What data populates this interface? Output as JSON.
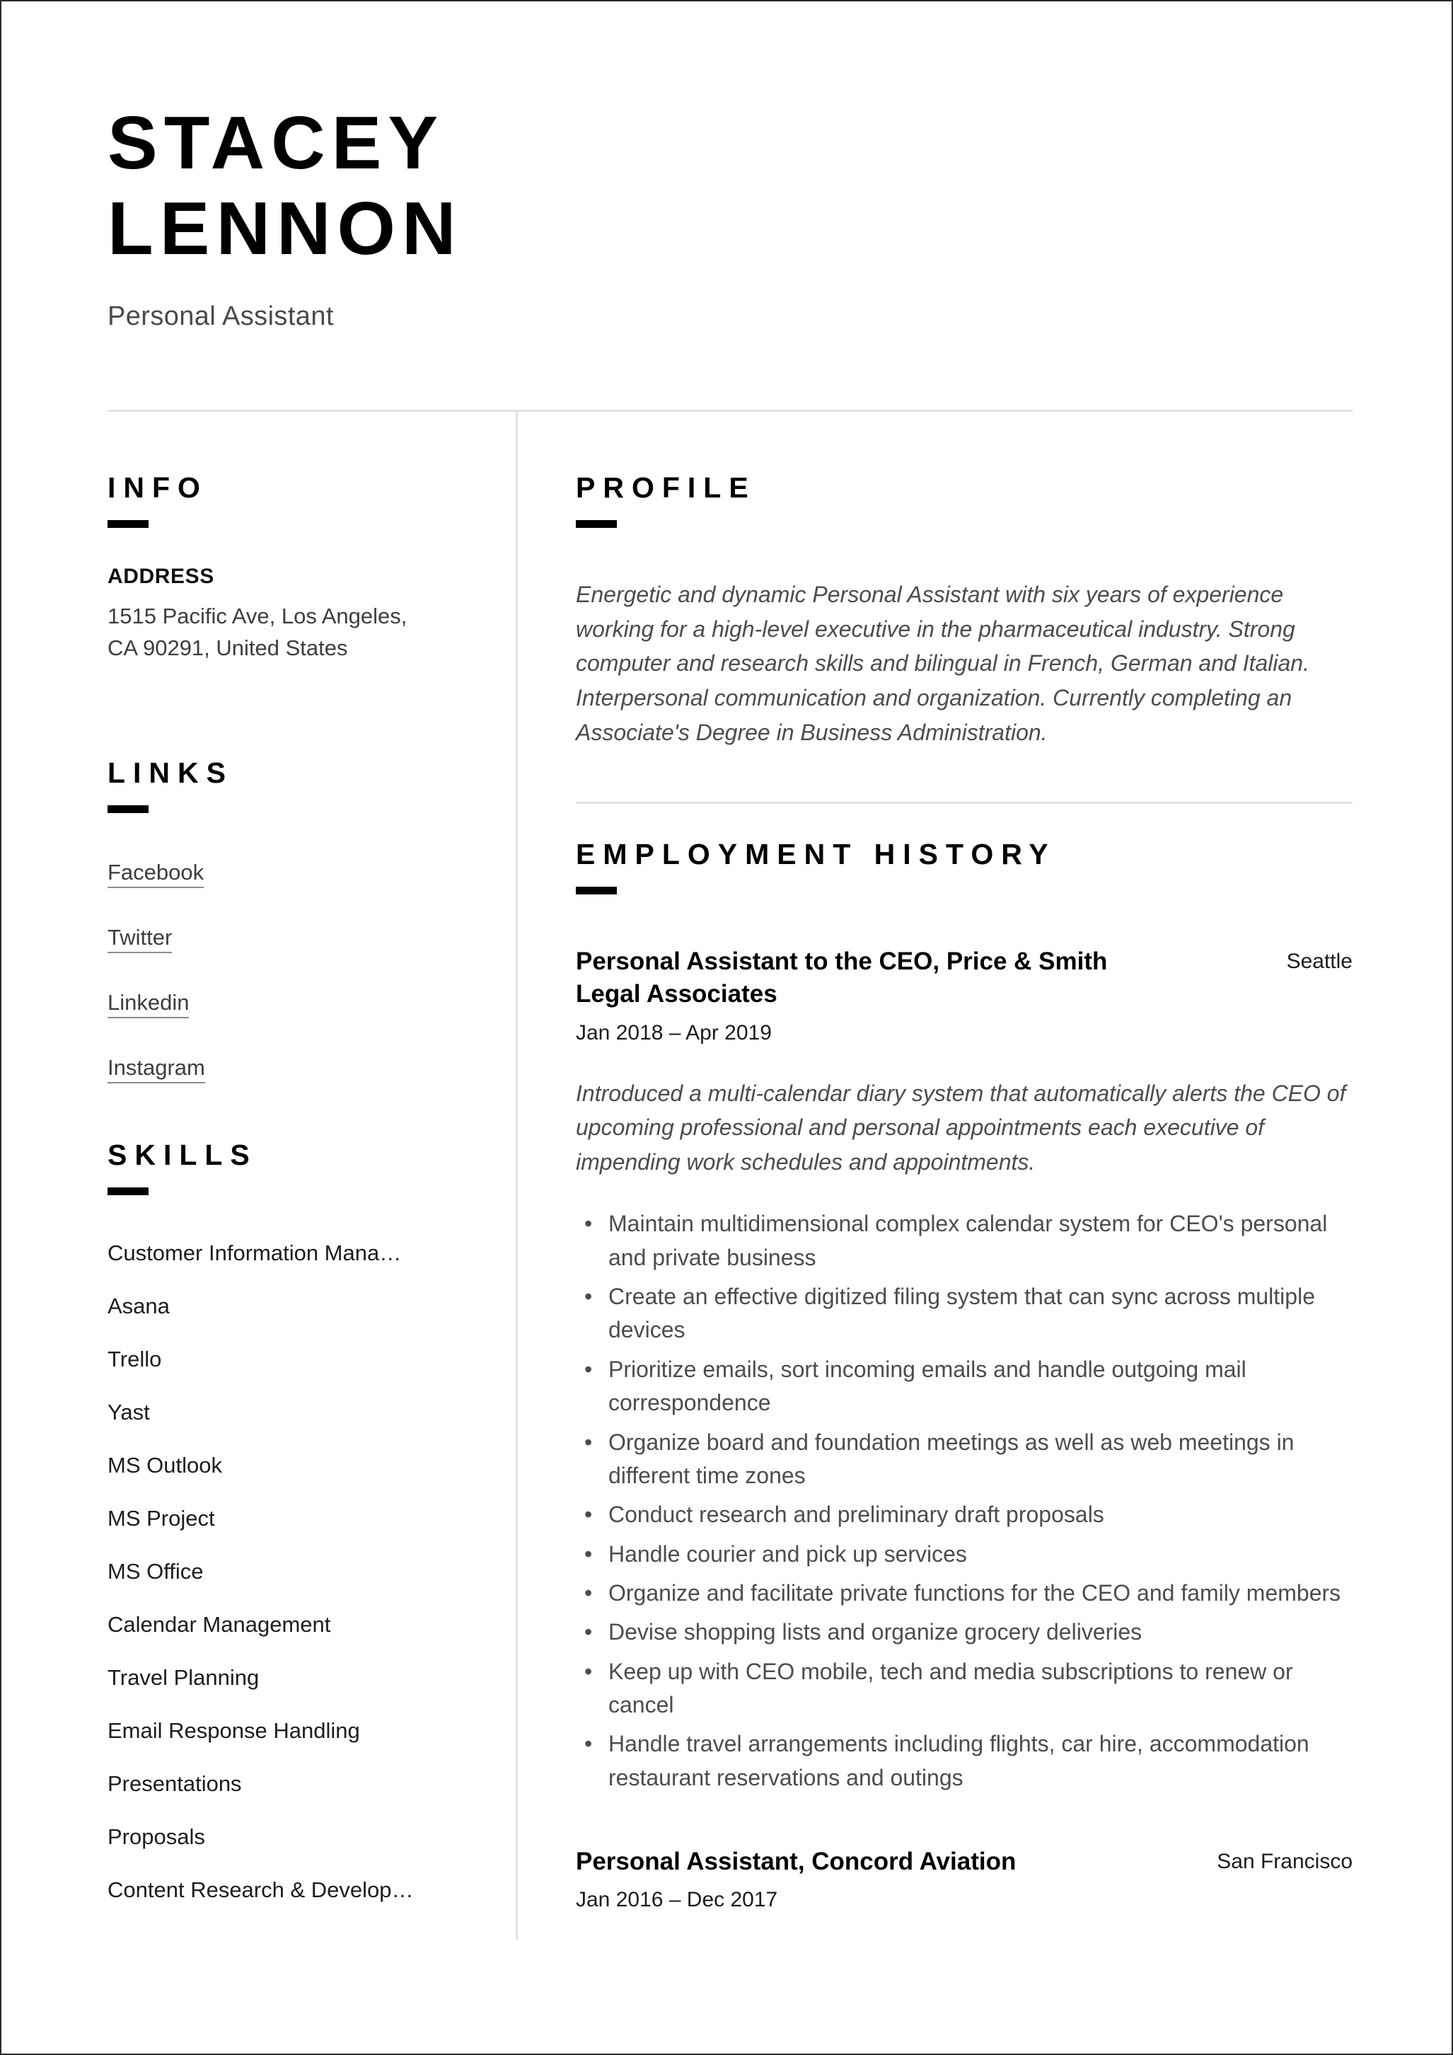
{
  "header": {
    "first_name": "STACEY",
    "last_name": "LENNON",
    "job_title": "Personal Assistant"
  },
  "sidebar": {
    "info": {
      "heading": "INFO",
      "address_label": "ADDRESS",
      "address_line1": "1515 Pacific Ave, Los Angeles,",
      "address_line2": "CA 90291, United States"
    },
    "links": {
      "heading": "LINKS",
      "items": [
        {
          "label": "Facebook"
        },
        {
          "label": "Twitter"
        },
        {
          "label": "Linkedin"
        },
        {
          "label": "Instagram"
        }
      ]
    },
    "skills": {
      "heading": "SKILLS",
      "items": [
        {
          "label": "Customer Information Mana…"
        },
        {
          "label": "Asana"
        },
        {
          "label": "Trello"
        },
        {
          "label": "Yast"
        },
        {
          "label": "MS Outlook"
        },
        {
          "label": "MS Project"
        },
        {
          "label": "MS Office"
        },
        {
          "label": "Calendar Management"
        },
        {
          "label": "Travel Planning"
        },
        {
          "label": "Email Response Handling"
        },
        {
          "label": "Presentations"
        },
        {
          "label": "Proposals"
        },
        {
          "label": "Content Research & Develop…"
        }
      ]
    }
  },
  "main": {
    "profile": {
      "heading": "PROFILE",
      "text": "Energetic and dynamic Personal Assistant with six years of experience working for a high-level executive in the pharmaceutical industry. Strong computer and research skills and bilingual in French, German and Italian. Interpersonal communication and organization. Currently completing an Associate's Degree in Business Administration."
    },
    "employment": {
      "heading": "EMPLOYMENT HISTORY",
      "jobs": [
        {
          "role": "Personal Assistant to the CEO, Price & Smith Legal Associates",
          "location": "Seattle",
          "dates": "Jan 2018 – Apr 2019",
          "description": "Introduced a multi-calendar diary system that automatically alerts the CEO of upcoming professional and personal appointments each executive of impending work schedules and appointments.",
          "bullets": [
            "Maintain multidimensional complex calendar system for CEO's personal and private business",
            "Create an effective digitized filing system that can sync across multiple devices",
            "Prioritize emails, sort incoming emails and handle outgoing mail correspondence",
            "Organize board and foundation meetings as well as web meetings in different time zones",
            "Conduct research and preliminary draft proposals",
            "Handle courier and pick up services",
            "Organize and facilitate private functions for the CEO and family members",
            "Devise shopping lists and organize grocery deliveries",
            "Keep up with CEO mobile, tech and media subscriptions to renew or cancel",
            "Handle travel arrangements including flights, car hire, accommodation restaurant reservations and outings"
          ]
        },
        {
          "role": "Personal Assistant, Concord Aviation",
          "location": "San Francisco",
          "dates": "Jan 2016 – Dec 2017",
          "description": "",
          "bullets": []
        }
      ]
    }
  },
  "theme": {
    "text_color": "#000000",
    "muted_text_color": "#4c4c4c",
    "rule_color": "#e3e3e3",
    "accent_bar_color": "#000000",
    "page_background": "#ffffff"
  }
}
